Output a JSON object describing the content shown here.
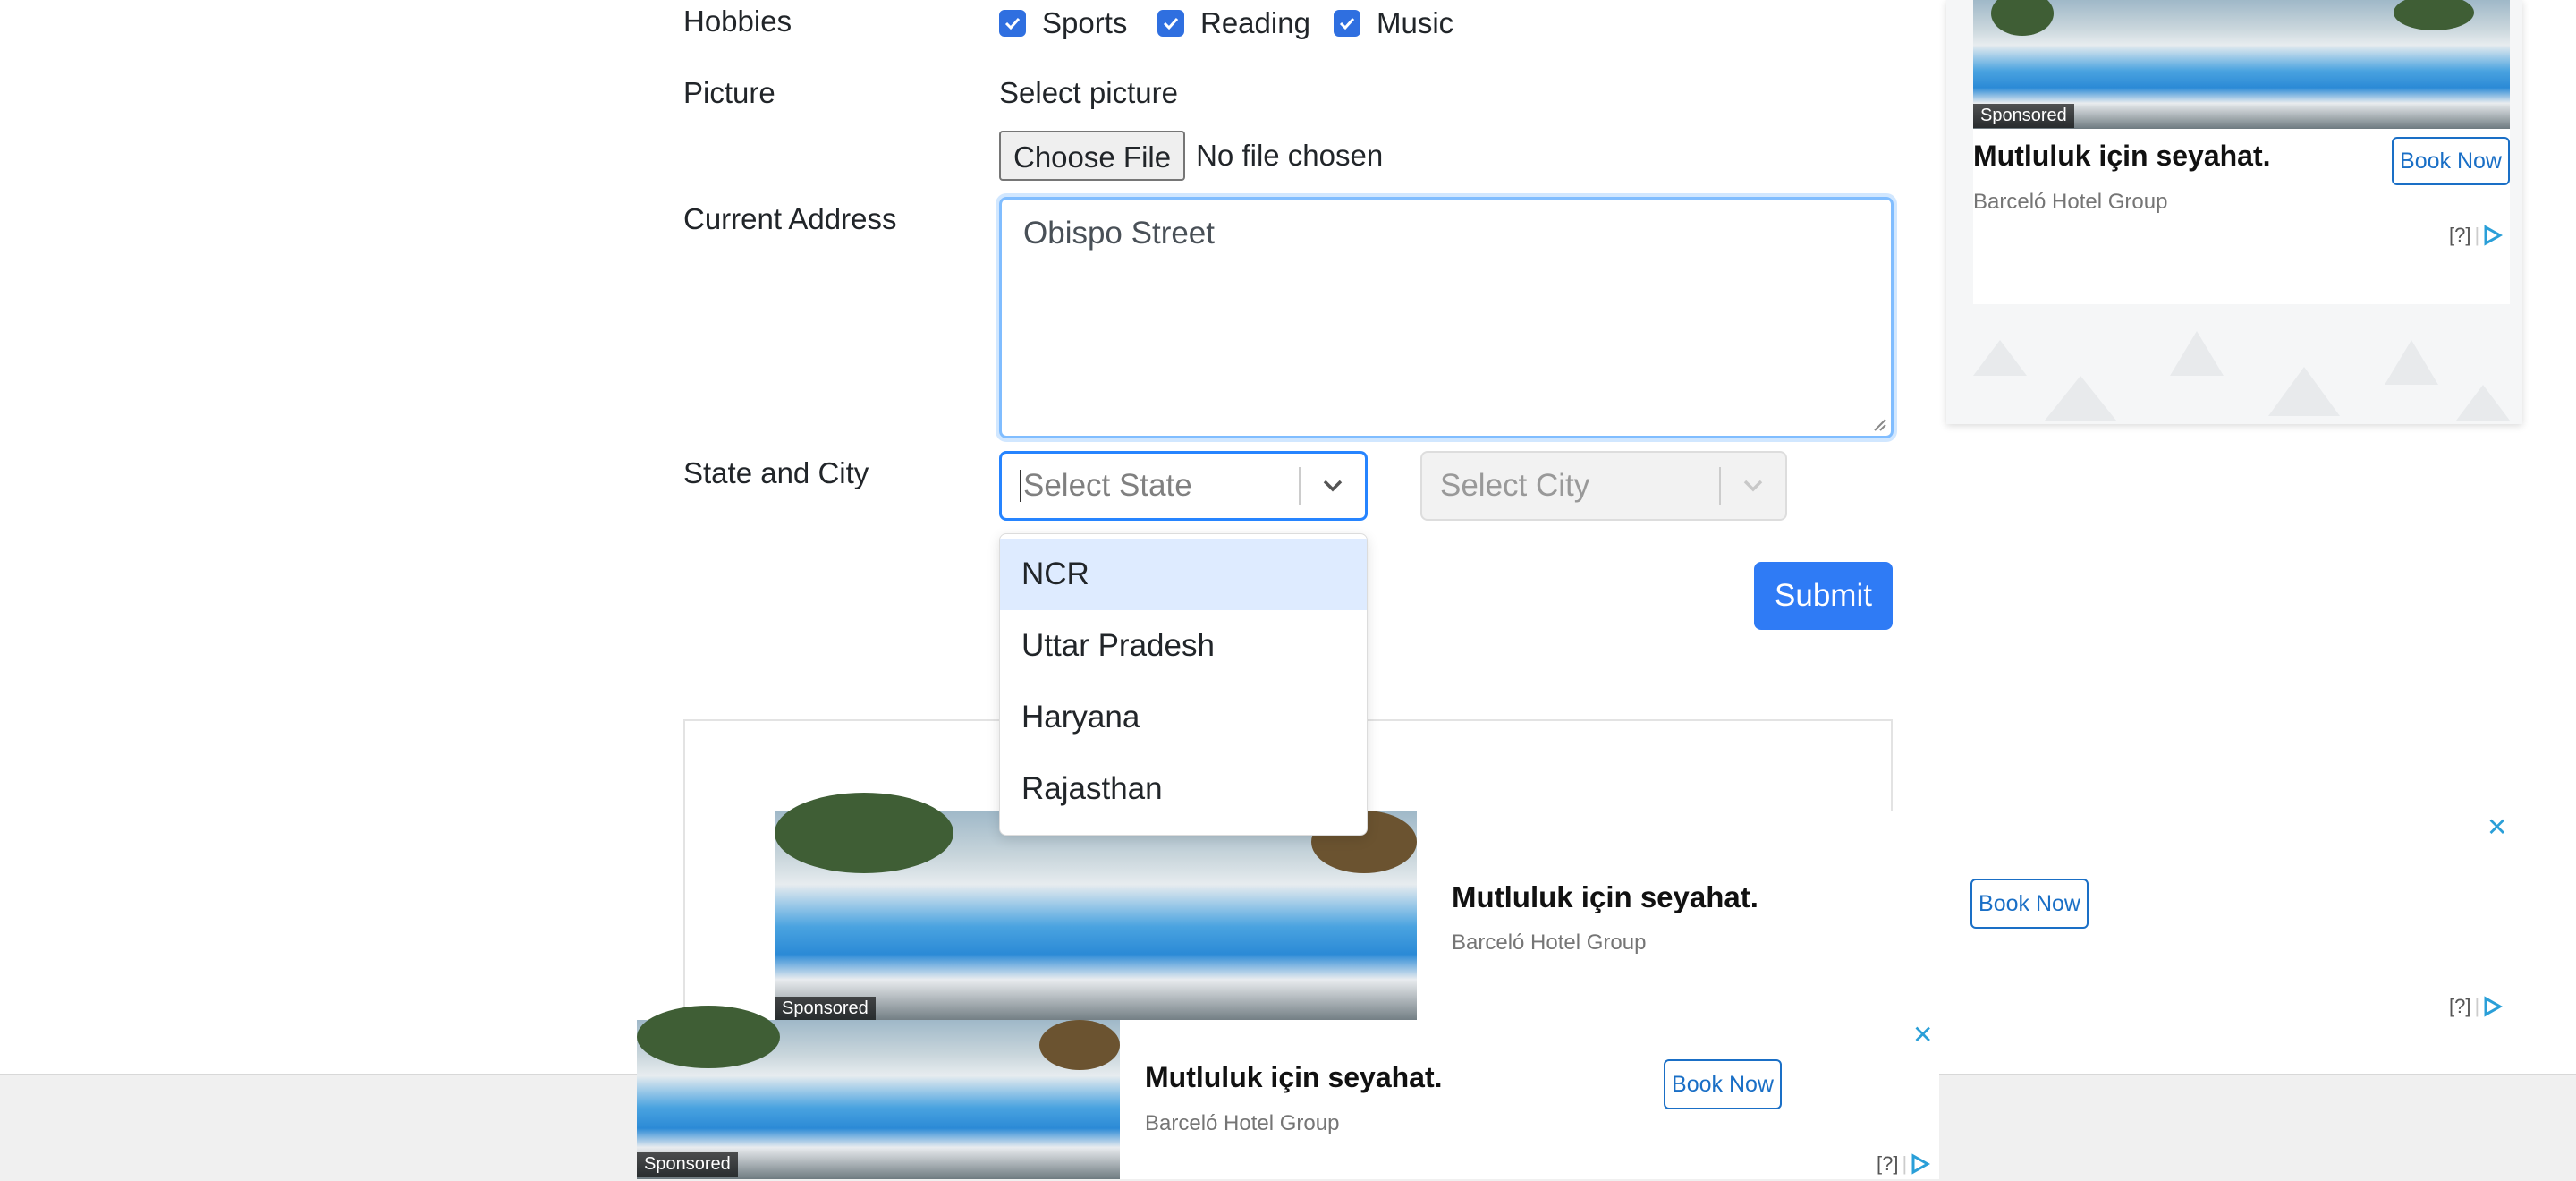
{
  "form": {
    "hobbies_label": "Hobbies",
    "hobbies": [
      "Sports",
      "Reading",
      "Music"
    ],
    "picture_label": "Picture",
    "select_picture_label": "Select picture",
    "choose_file_label": "Choose File",
    "no_file_label": "No file chosen",
    "address_label": "Current Address",
    "address_value": "Obispo Street",
    "state_city_label": "State and City",
    "state_placeholder": "Select State",
    "city_placeholder": "Select City",
    "state_options": [
      "NCR",
      "Uttar Pradesh",
      "Haryana",
      "Rajasthan"
    ],
    "highlighted_option": "NCR",
    "submit_label": "Submit"
  },
  "ads": {
    "sponsored": "Sponsored",
    "title": "Mutluluk için seyahat.",
    "brand": "Barceló Hotel Group",
    "cta": "Book Now",
    "adchoices": "[?]",
    "close": "✕"
  },
  "colors": {
    "accent": "#2f7bf5",
    "option_highlight": "#deebff",
    "ad_link": "#1a6fc6"
  }
}
